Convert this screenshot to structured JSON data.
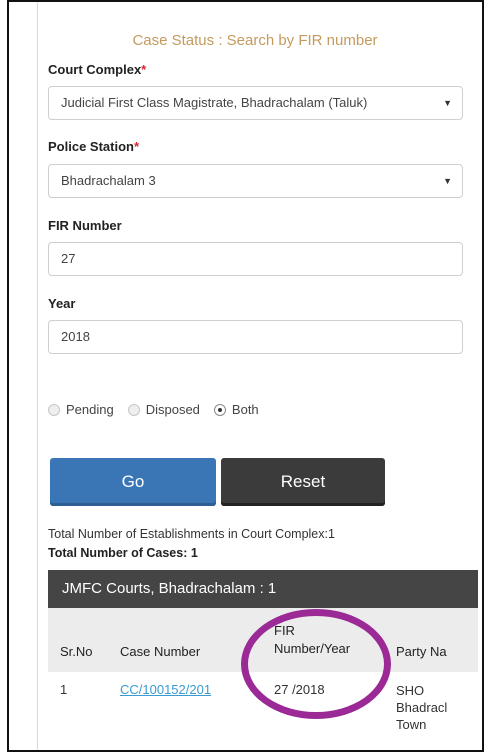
{
  "form": {
    "title": "Case Status : Search by FIR number",
    "court_complex_label": "Court Complex",
    "court_complex_value": "Judicial First Class Magistrate, Bhadrachalam (Taluk)",
    "police_station_label": "Police Station",
    "police_station_value": "Bhadrachalam 3",
    "fir_number_label": "FIR Number",
    "fir_number_value": "27",
    "year_label": "Year",
    "year_value": "2018",
    "required_mark": "*",
    "dropdown_icon": "caret-down",
    "status_options": [
      {
        "label": "Pending",
        "selected": false
      },
      {
        "label": "Disposed",
        "selected": false
      },
      {
        "label": "Both",
        "selected": true
      }
    ],
    "go_label": "Go",
    "reset_label": "Reset"
  },
  "results": {
    "establishments_text": "Total Number of Establishments in Court Complex:1",
    "cases_text": "Total Number of Cases: 1",
    "court_heading": "JMFC Courts, Bhadrachalam : 1",
    "columns": [
      "Sr.No",
      "Case Number",
      "FIR Number/Year",
      "Party Na"
    ],
    "rows": [
      {
        "sr_no": "1",
        "case_number": "CC/100152/201",
        "fir_year": "27 /2018",
        "party": "SHO Bhadracl Town"
      }
    ]
  },
  "colors": {
    "title": "#c49a5e",
    "go_button": "#3a76b5",
    "reset_button": "#3b3b3b",
    "highlight_circle": "#9b2a97"
  }
}
